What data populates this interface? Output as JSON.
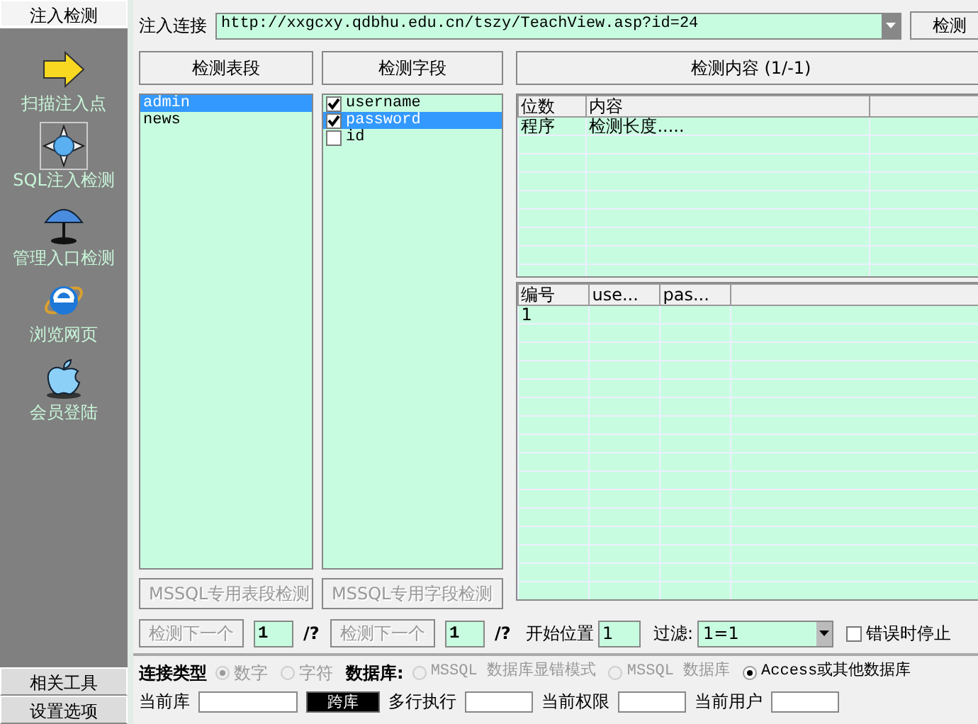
{
  "sidebar": {
    "top_tab": {
      "label": "注入检测",
      "selected": true
    },
    "items": [
      {
        "label": "扫描注入点",
        "selected": false
      },
      {
        "label": "SQL注入检测",
        "selected": true
      },
      {
        "label": "管理入口检测",
        "selected": false
      },
      {
        "label": "浏览网页",
        "selected": false
      },
      {
        "label": "会员登陆",
        "selected": false
      }
    ],
    "bottom_tabs": [
      {
        "label": "相关工具"
      },
      {
        "label": "设置选项"
      }
    ]
  },
  "url_bar": {
    "label": "注入连接",
    "value": "http://xxgcxy.qdbhu.edu.cn/tszy/TeachView.asp?id=24",
    "button": "检测"
  },
  "tables_panel": {
    "title": "检测表段",
    "items": [
      {
        "label": "admin",
        "selected": true
      },
      {
        "label": "news",
        "selected": false
      }
    ],
    "button": "MSSQL专用表段检测",
    "button_disabled": true
  },
  "fields_panel": {
    "title": "检测字段",
    "items": [
      {
        "label": "username",
        "checked": true,
        "selected": false
      },
      {
        "label": "password",
        "checked": true,
        "selected": true
      },
      {
        "label": "id",
        "checked": false,
        "selected": false
      }
    ],
    "button": "MSSQL专用字段检测",
    "button_disabled": true
  },
  "content_panel": {
    "title": "检测内容 (1/-1)",
    "grid": {
      "columns": [
        "位数",
        "内容"
      ],
      "rows": [
        [
          "程序",
          "检测长度....."
        ]
      ]
    },
    "results": {
      "columns": [
        "编号",
        "use...",
        "pas..."
      ],
      "rows": [
        [
          "1"
        ]
      ]
    }
  },
  "next_controls": [
    {
      "button": "检测下一个",
      "disabled": true,
      "value": "1",
      "suffix": "/?"
    },
    {
      "button": "检测下一个",
      "disabled": true,
      "value": "1",
      "suffix": "/?"
    }
  ],
  "start": {
    "label": "开始位置",
    "value": "1"
  },
  "filter": {
    "label": "过滤:",
    "value": "1=1"
  },
  "stop_on_error": {
    "label": "错误时停止",
    "checked": false
  },
  "connection_type": {
    "label": "连接类型",
    "options": [
      {
        "label": "数字",
        "selected": true,
        "disabled": true
      },
      {
        "label": "字符",
        "selected": false,
        "disabled": true
      }
    ]
  },
  "database": {
    "label": "数据库:",
    "options": [
      {
        "label": "MSSQL 数据库显错模式",
        "selected": false,
        "disabled": true
      },
      {
        "label": "MSSQL 数据库",
        "selected": false,
        "disabled": true
      },
      {
        "label": "Access或其他数据库",
        "selected": true,
        "disabled": false
      }
    ]
  },
  "bottom_row": [
    {
      "kind": "field",
      "label": "当前库"
    },
    {
      "kind": "button",
      "label": "跨库"
    },
    {
      "kind": "field",
      "label": "多行执行"
    },
    {
      "kind": "field",
      "label": "当前权限"
    },
    {
      "kind": "field",
      "label": "当前用户"
    }
  ]
}
